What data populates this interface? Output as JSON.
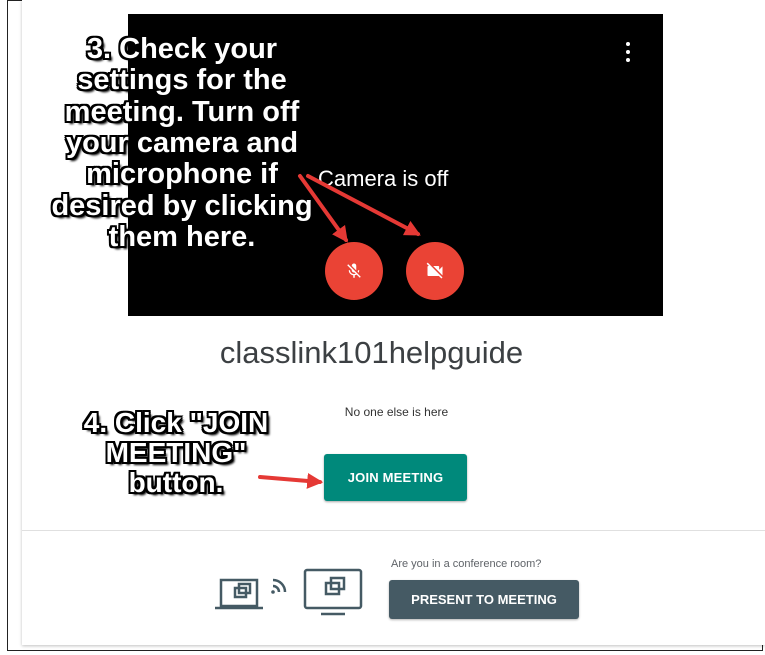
{
  "video_preview": {
    "camera_status": "Camera is off",
    "mic_button": {
      "icon": "mic-off-icon",
      "color": "#ea4335"
    },
    "camera_button": {
      "icon": "videocam-off-icon",
      "color": "#ea4335"
    },
    "menu_icon": "more-vert-icon"
  },
  "meeting": {
    "name": "classlink101helpguide",
    "participants_text": "No one else is here",
    "join_button": "JOIN MEETING",
    "join_color": "#00897b"
  },
  "conference": {
    "question": "Are you in a conference room?",
    "present_button": "PRESENT TO MEETING",
    "illustration": "cast-to-screen-icon"
  },
  "annotations": {
    "step3_lines": [
      "3. Check your",
      "settings for the",
      "meeting. Turn off",
      "your camera and",
      "microphone if",
      "desired by clicking",
      "them here."
    ],
    "step4_lines": [
      "4. Click \"JOIN",
      "MEETING\"",
      "button."
    ],
    "arrow_color": "#e53935"
  }
}
